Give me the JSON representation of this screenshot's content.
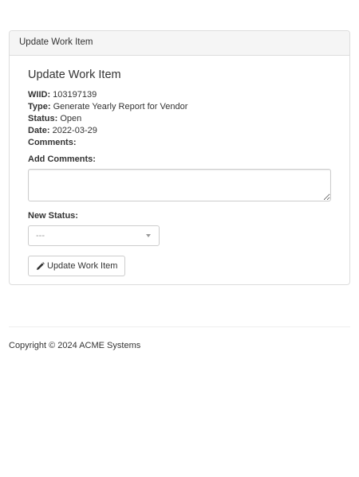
{
  "panel": {
    "heading": "Update Work Item"
  },
  "form": {
    "title": "Update Work Item",
    "wiid_label": "WIID:",
    "wiid_value": "103197139",
    "type_label": "Type:",
    "type_value": "Generate Yearly Report for Vendor",
    "status_label": "Status:",
    "status_value": "Open",
    "date_label": "Date:",
    "date_value": "2022-03-29",
    "comments_label": "Comments:",
    "add_comments_label": "Add Comments:",
    "add_comments_value": "",
    "new_status_label": "New Status:",
    "new_status_selected": "---",
    "submit_label": "Update Work Item",
    "submit_icon": "pencil-icon"
  },
  "footer": {
    "copyright": "Copyright © 2024 ACME Systems"
  }
}
